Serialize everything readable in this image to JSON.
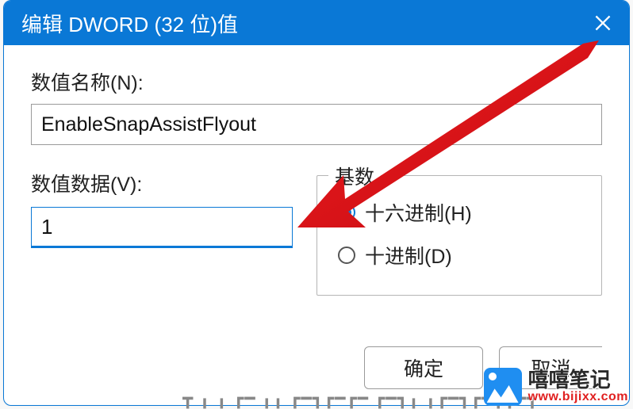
{
  "title": "编辑 DWORD (32 位)值",
  "labels": {
    "name": "数值名称(N):",
    "value": "数值数据(V):",
    "radix_group": "基数"
  },
  "fields": {
    "name_value": "EnableSnapAssistFlyout",
    "data_value": "1"
  },
  "radix": {
    "hex": {
      "label": "十六进制(H)",
      "checked": true
    },
    "dec": {
      "label": "十进制(D)",
      "checked": false
    }
  },
  "buttons": {
    "ok": "确定",
    "cancel": "取消"
  },
  "watermark": {
    "cn": "嘻嘻笔记",
    "url": "www.bijixx.com"
  },
  "annotation": {
    "type": "arrow",
    "color": "#e8191e",
    "points_to": "value-data-input"
  }
}
